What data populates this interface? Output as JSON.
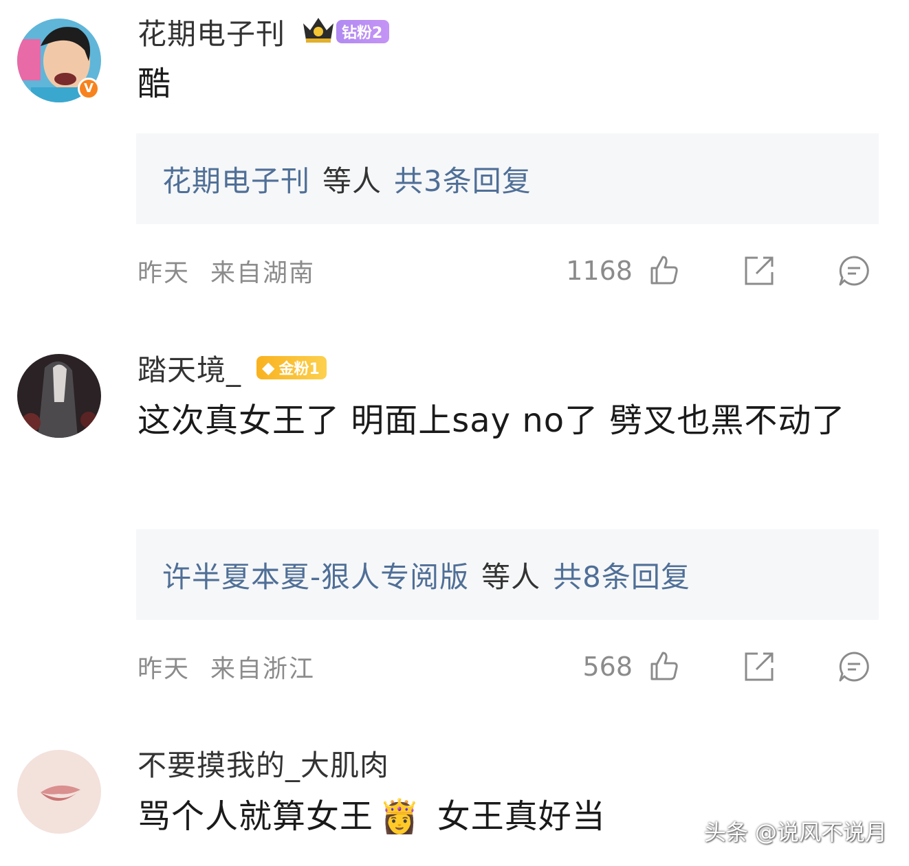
{
  "comments": [
    {
      "username": "花期电子刊",
      "badge": "钻粉2",
      "badge_color": "#b18af2",
      "verified": true,
      "text": "酷",
      "reply": {
        "names": "花期电子刊",
        "middle": "等人",
        "count": "共3条回复"
      },
      "time": "昨天",
      "location": "来自湖南",
      "likes": "1168"
    },
    {
      "username": "踏天境_",
      "badge": "金粉1",
      "badge_color": "#f9b21f",
      "verified": false,
      "text": "这次真女王了 明面上say no了 劈叉也黑不动了",
      "reply": {
        "names": "许半夏本夏-狠人专阅版",
        "middle": "等人",
        "count": "共8条回复"
      },
      "time": "昨天",
      "location": "来自浙江",
      "likes": "568"
    },
    {
      "username": "不要摸我的_大肌肉",
      "text": "骂个人就算女王",
      "emoji": "👸",
      "text_tail": "女王真好当"
    }
  ],
  "watermark": "头条 @说风不说月",
  "icons": {
    "like": "thumbs-up-icon",
    "share": "share-icon",
    "comment": "comment-bubble-icon",
    "crown": "crown-icon",
    "diamond": "diamond-icon"
  }
}
